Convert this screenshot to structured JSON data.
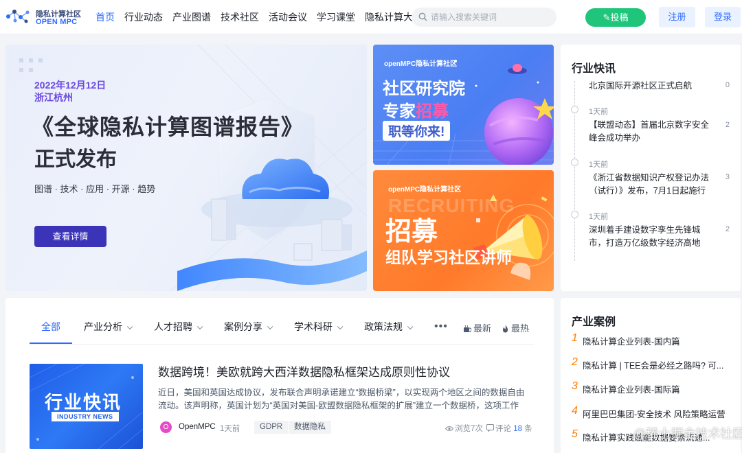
{
  "header": {
    "logo_cn": "隐私计算社区",
    "logo_en": "OPEN MPC",
    "nav": [
      {
        "label": "首页",
        "active": true
      },
      {
        "label": "行业动态"
      },
      {
        "label": "产业图谱"
      },
      {
        "label": "技术社区"
      },
      {
        "label": "活动会议"
      },
      {
        "label": "学习课堂"
      },
      {
        "label": "隐私计算大赛"
      }
    ],
    "search_placeholder": "请输入搜索关键词",
    "post_label": "✎投稿",
    "register_label": "注册",
    "login_label": "登录"
  },
  "hero": {
    "date": "2022年12月12日",
    "place": "浙江杭州",
    "title_line1": "《全球隐私计算图谱报告》",
    "title_line2": "正式发布",
    "tags": "图谱 · 技术 · 应用 · 开源 · 趋势",
    "button": "查看详情"
  },
  "promo1": {
    "brand": "openMPC隐私计算社区",
    "line1": "社区研究院",
    "line2_a": "专家",
    "line2_b": "招募",
    "badge": "职等你来!"
  },
  "promo2": {
    "brand": "openMPC隐私计算社区",
    "ghost": "RECRUITING",
    "line1": "招募",
    "line2": "组队学习社区讲师"
  },
  "news": {
    "title": "行业快讯",
    "items": [
      {
        "time": "",
        "text": "北京国际开源社区正式启航",
        "count": "0"
      },
      {
        "time": "1天前",
        "text": "【联盟动态】首届北京数字安全峰会成功举办",
        "count": "2"
      },
      {
        "time": "1天前",
        "text": "《浙江省数据知识产权登记办法（试行）》发布，7月1日起施行",
        "count": "3"
      },
      {
        "time": "1天前",
        "text": "深圳着手建设数字孪生先锋城市，打造万亿级数字经济高地",
        "count": "2"
      }
    ]
  },
  "tabs": [
    {
      "label": "全部",
      "active": true,
      "dropdown": false
    },
    {
      "label": "产业分析",
      "dropdown": true
    },
    {
      "label": "人才招聘",
      "dropdown": true
    },
    {
      "label": "案例分享",
      "dropdown": true
    },
    {
      "label": "学术科研",
      "dropdown": true
    },
    {
      "label": "政策法规",
      "dropdown": true
    },
    {
      "label": "•••",
      "dropdown": false
    }
  ],
  "sort": {
    "newest": "最新",
    "hottest": "最热"
  },
  "article": {
    "thumb_cn": "行业快讯",
    "thumb_en": "INDUSTRY NEWS",
    "title": "数据跨境！美欧就跨大西洋数据隐私框架达成原则性协议",
    "summary": "近日，美国和英国达成协议，发布联合声明承诺建立“数据桥梁”，以实现两个地区之间的数据自由流动。该声明称，英国计划为“英国对美国-欧盟数据隐私框架的扩展”建立一个数据桥，这项工作取...",
    "avatar": "O",
    "author": "OpenMPC",
    "time": "1天前",
    "tags": [
      "GDPR",
      "数据隐私"
    ],
    "views": "浏览7次",
    "comments_label": "评论",
    "comments": "18",
    "comments_suffix": "条"
  },
  "cases": {
    "title": "产业案例",
    "items": [
      {
        "num": "1",
        "text": "隐私计算企业列表-国内篇"
      },
      {
        "num": "2",
        "text": "隐私计算 | TEE会是必经之路吗? 可..."
      },
      {
        "num": "3",
        "text": "隐私计算企业列表-国际篇"
      },
      {
        "num": "4",
        "text": "阿里巴巴集团-安全技术 风险策略运营"
      },
      {
        "num": "5",
        "text": "隐私计算实践赋能数据要素流通..."
      }
    ]
  },
  "watermark": "@稀土掘金技术社区",
  "colors": {
    "accent": "#2f6bff",
    "post": "#1fc57a",
    "hero_button": "#3b33b8",
    "case_number": "#ff7d00"
  }
}
